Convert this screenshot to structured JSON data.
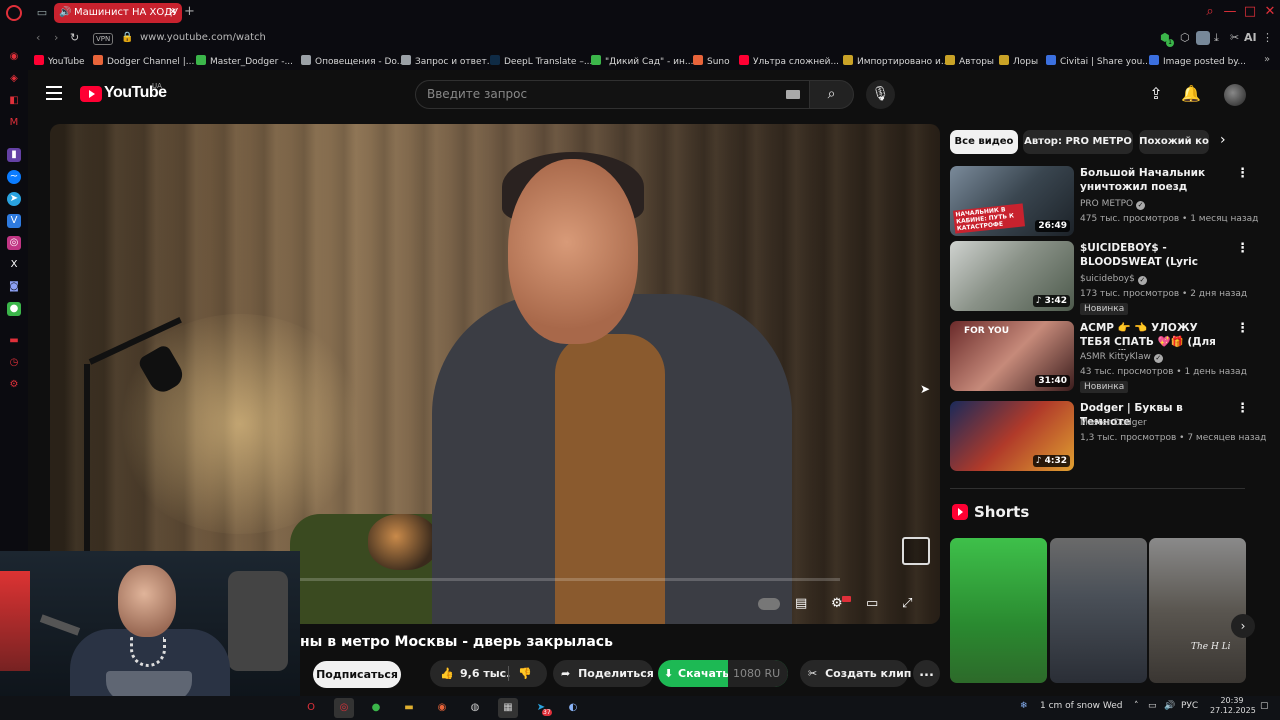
{
  "browser": {
    "tab_title": "Машинист НА ХОДУ",
    "url": "www.youtube.com/watch",
    "vpn_label": "VPN",
    "ai_label": "AI",
    "extension_badge": "1",
    "bookmarks": [
      {
        "label": "YouTube",
        "color": "#ff0033"
      },
      {
        "label": "Dodger Channel |...",
        "color": "#e8643a"
      },
      {
        "label": "Master_Dodger -...",
        "color": "#3bb54a"
      },
      {
        "label": "Оповещения - Do...",
        "color": "#9aa0a6"
      },
      {
        "label": "Запрос и ответ.",
        "color": "#9aa0a6"
      },
      {
        "label": "DeepL Translate –...",
        "color": "#0f2b46"
      },
      {
        "label": "\"Дикий Сад\" - ин...",
        "color": "#3bb54a"
      },
      {
        "label": "Suno",
        "color": "#e8643a"
      },
      {
        "label": "Ультра сложней...",
        "color": "#ff0033"
      },
      {
        "label": "Импортировано и...",
        "color": "#c9a227"
      },
      {
        "label": "Авторы",
        "color": "#c9a227"
      },
      {
        "label": "Лоры",
        "color": "#c9a227"
      },
      {
        "label": "Civitai | Share you...",
        "color": "#3b6fe0"
      },
      {
        "label": "Image posted by...",
        "color": "#3b6fe0"
      }
    ]
  },
  "youtube": {
    "logo_text": "YouTube",
    "region": "UA",
    "search_placeholder": "Введите запрос"
  },
  "video": {
    "title": "ны в метро Москвы - дверь закрылась",
    "subscribe_label": "Подписаться",
    "likes": "9,6 тыс.",
    "share_label": "Поделиться",
    "download_label": "Скачать",
    "quality": "1080",
    "quality_lang": "RU",
    "clip_label": "Создать клип",
    "more_label": "..."
  },
  "chips": [
    "Все видео",
    "Автор: PRO МЕТРО",
    "Похожий ко"
  ],
  "recommendations": [
    {
      "title": "Большой Начальник уничтожил поезд метро! ...",
      "channel": "PRO МЕТРО",
      "meta": "475 тыс. просмотров • 1 месяц назад",
      "duration": "26:49",
      "badge": "",
      "thumb_text": "НАЧАЛЬНИК В КАБИНЕ: ПУТЬ К КАТАСТРОФЕ"
    },
    {
      "title": "$UICIDEBOY$ - BLOODSWEAT (Lyric Video)",
      "channel": "$uicideboy$",
      "meta": "173 тыс. просмотров • 2 дня назад",
      "duration": "♪ 3:42",
      "badge": "Новинка",
      "thumb_text": ""
    },
    {
      "title": "АСМР 👉 👈 УЛОЖУ ТЕБЯ СПАТЬ 💖🎁 (Для сна) 😴 ...",
      "channel": "ASMR KittyKlaw",
      "meta": "43 тыс. просмотров • 1 день назад",
      "duration": "31:40",
      "badge": "Новинка",
      "thumb_text": "FOR YOU"
    },
    {
      "title": "Dodger | Буквы в Темноте",
      "channel": "Master Dodger",
      "meta": "1,3 тыс. просмотров • 7 месяцев назад",
      "duration": "♪ 4:32",
      "badge": "",
      "thumb_text": ""
    }
  ],
  "shorts": {
    "title": "Shorts",
    "last_thumb_text": "The H Li"
  },
  "taskbar": {
    "weather": "1 cm of snow Wed",
    "lang": "РУС",
    "time": "20:39",
    "date": "27.12.2025",
    "steam_badge": "37"
  }
}
